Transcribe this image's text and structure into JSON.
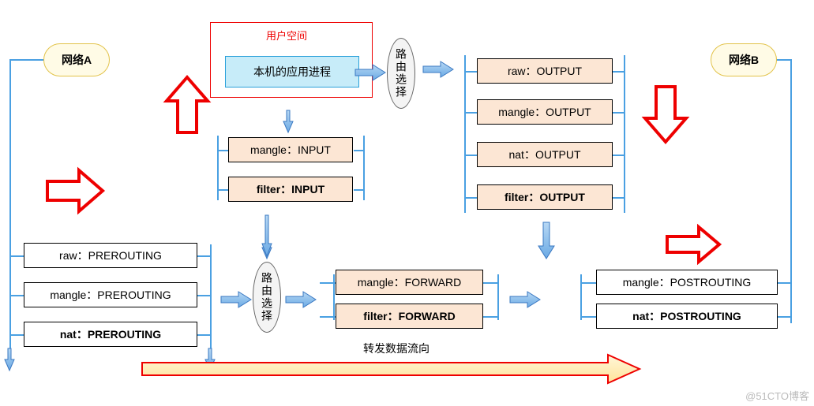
{
  "clouds": {
    "netA": "网络A",
    "netB": "网络B"
  },
  "userspace": {
    "title": "用户空间",
    "proc": "本机的应用进程"
  },
  "routing": "路由选择",
  "prerouting": [
    "raw：PREROUTING",
    "mangle：PREROUTING",
    "nat：PREROUTING"
  ],
  "input": [
    "mangle：INPUT",
    "filter：INPUT"
  ],
  "output": [
    "raw：OUTPUT",
    "mangle：OUTPUT",
    "nat：OUTPUT",
    "filter：OUTPUT"
  ],
  "forward": [
    "mangle：FORWARD",
    "filter：FORWARD"
  ],
  "postrouting": [
    "mangle：POSTROUTING",
    "nat：POSTROUTING"
  ],
  "forward_flow_label": "转发数据流向",
  "watermark": "@51CTO博客"
}
